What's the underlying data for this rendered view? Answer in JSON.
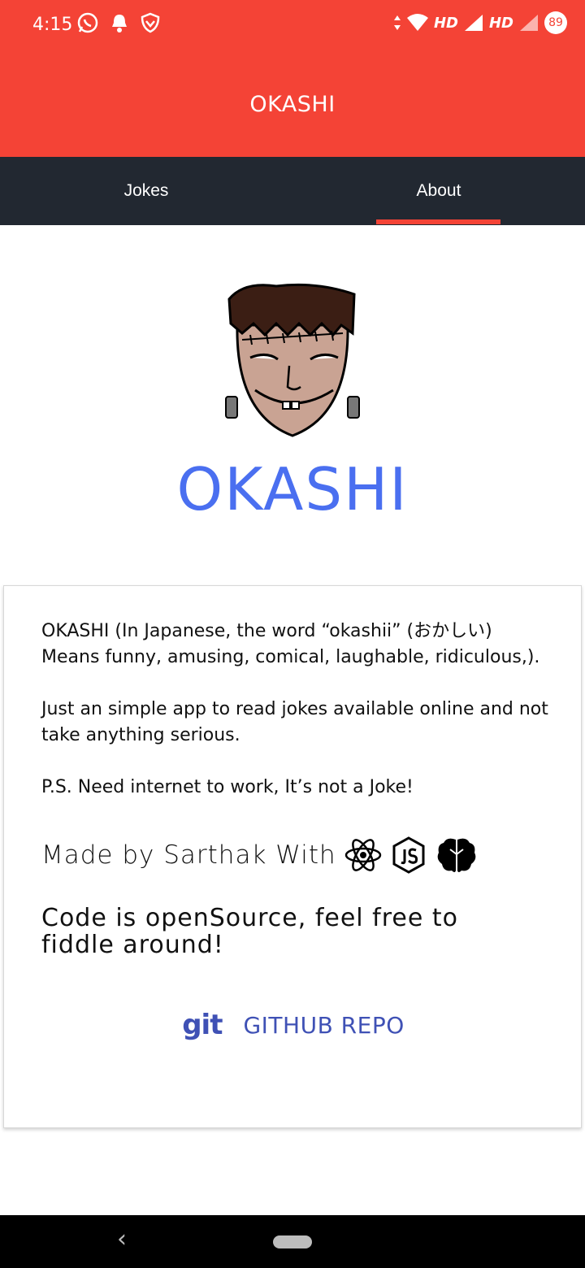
{
  "status": {
    "time": "4:15",
    "net1": "HD",
    "net2": "HD",
    "battery": "89"
  },
  "app": {
    "title": "OKASHI"
  },
  "tabs": [
    {
      "label": "Jokes"
    },
    {
      "label": "About"
    }
  ],
  "brand": "OKASHI",
  "about": {
    "para1": "OKASHI (In Japanese, the word “okashii” (おかしい) Means funny, amusing, comical, laughable, ridiculous,).",
    "para2": "Just an simple app to read jokes available online and not take anything serious.",
    "para3": "P.S. Need internet to work, It’s not a Joke!",
    "made_by": "Made by Sarthak With",
    "code_note": "Code is openSource, feel free to fiddle around!",
    "git_icon_text": "git",
    "github_label": "GITHUB REPO"
  },
  "icons": {
    "left": [
      "whatsapp-icon",
      "bell-icon",
      "shield-icon"
    ],
    "made_with": [
      "react-icon",
      "nodejs-icon",
      "brain-icon"
    ]
  },
  "colors": {
    "primary": "#f44336",
    "tabbar": "#222831",
    "brand": "#4a6ff0",
    "link": "#3f51b5"
  }
}
